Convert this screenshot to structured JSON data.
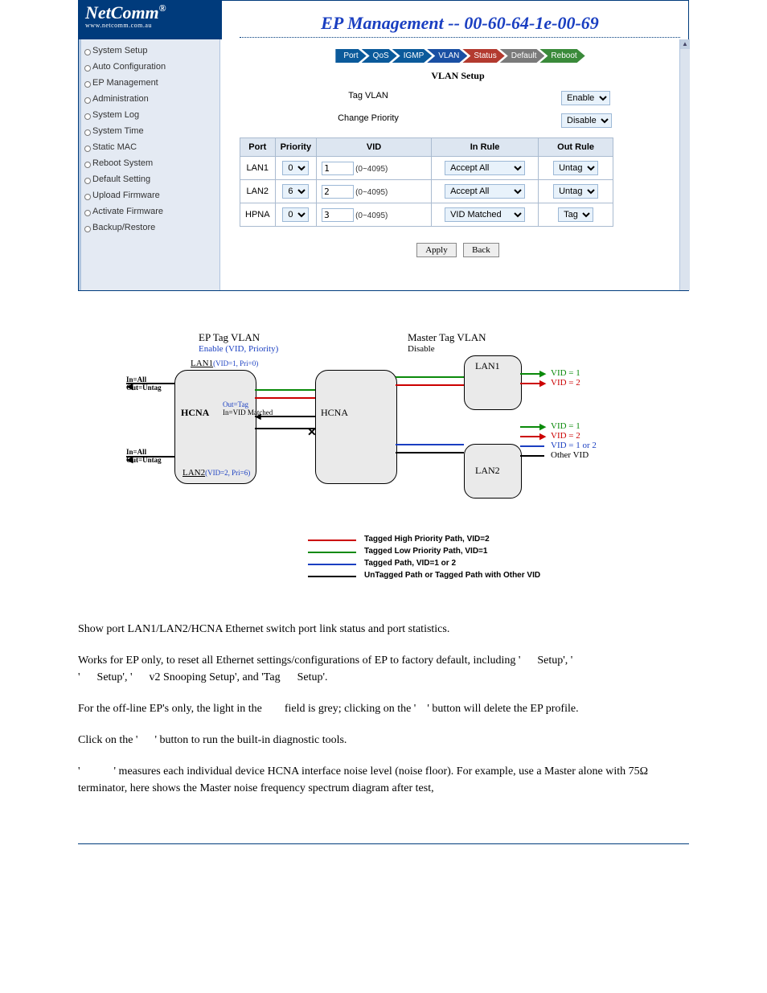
{
  "logo": {
    "brand": "NetComm",
    "url": "www.netcomm.com.au",
    "trademark": "®"
  },
  "header": {
    "title": "EP Management -- 00-60-64-1e-00-69"
  },
  "tabs": [
    {
      "label": "Port",
      "style": "first"
    },
    {
      "label": "QoS",
      "style": ""
    },
    {
      "label": "IGMP",
      "style": ""
    },
    {
      "label": "VLAN",
      "style": "active"
    },
    {
      "label": "Status",
      "style": "red"
    },
    {
      "label": "Default",
      "style": "grey"
    },
    {
      "label": "Reboot",
      "style": "green"
    }
  ],
  "section_title": "VLAN Setup",
  "tag_vlan": {
    "label": "Tag VLAN",
    "value": "Enable"
  },
  "change_priority": {
    "label": "Change Priority",
    "value": "Disable"
  },
  "table": {
    "headers": [
      "Port",
      "Priority",
      "VID",
      "In Rule",
      "Out Rule"
    ],
    "vid_range": "(0~4095)",
    "rows": [
      {
        "port": "LAN1",
        "priority": "0",
        "vid": "1",
        "in_rule": "Accept All",
        "out_rule": "Untag"
      },
      {
        "port": "LAN2",
        "priority": "6",
        "vid": "2",
        "in_rule": "Accept All",
        "out_rule": "Untag"
      },
      {
        "port": "HPNA",
        "priority": "0",
        "vid": "3",
        "in_rule": "VID Matched",
        "out_rule": "Tag"
      }
    ]
  },
  "buttons": {
    "apply": "Apply",
    "back": "Back"
  },
  "sidebar": {
    "items": [
      "System Setup",
      "Auto Configuration",
      "EP Management",
      "Administration",
      "System Log",
      "System Time",
      "Static MAC",
      "Reboot System",
      "Default Setting",
      "Upload Firmware",
      "Activate Firmware",
      "Backup/Restore"
    ]
  },
  "diagram": {
    "ep_title": "EP Tag VLAN",
    "ep_sub": "Enable (VID, Priority)",
    "lan1": "LAN1",
    "lan1_cfg": "(VID=1, Pri=0)",
    "lan2": "LAN2",
    "lan2_cfg": "(VID=2, Pri=6)",
    "rule_in": "In=All",
    "rule_out": "Out=Untag",
    "hcna": "HCNA",
    "hcna_out": "Out=Tag",
    "hcna_in": "In=VID Matched",
    "x_mark": "✕",
    "master_title": "Master Tag VLAN",
    "master_sub": "Disable",
    "m_hcna": "HCNA",
    "m_lan1": "LAN1",
    "m_lan2": "LAN2",
    "vid1": "VID = 1",
    "vid2": "VID = 2",
    "vid1or2": "VID = 1 or 2",
    "othervid": "Other VID",
    "legend": [
      {
        "color": "#c00",
        "text": "Tagged High Priority Path, VID=2"
      },
      {
        "color": "#0a8a0a",
        "text": "Tagged Low Priority Path, VID=1"
      },
      {
        "color": "#1a3fc1",
        "text": "Tagged Path, VID=1 or 2"
      },
      {
        "color": "#000",
        "text": "UnTagged Path or Tagged Path with Other VID"
      }
    ]
  },
  "doc": {
    "p1": "Show port LAN1/LAN2/HCNA Ethernet switch port link status and port statistics.",
    "p2a": "Works for EP only, to reset all Ethernet settings/configurations of EP to factory default, including '",
    "p2b": "Setup', '",
    "p2c": "Setup', '",
    "p2d": "v2 Snooping Setup', and 'Tag",
    "p2e": "Setup'.",
    "p3a": "For the off-line EP's only, the light in the",
    "p3b": "field is grey; clicking on the '",
    "p3c": "' button will delete the EP profile.",
    "p4a": "Click on the '",
    "p4b": "' button to run the built-in diagnostic tools.",
    "p5a": "'",
    "p5b": "' measures each individual device HCNA interface noise level (noise floor). For example, use a Master alone with 75Ω terminator, here shows the Master noise frequency spectrum diagram after test,"
  }
}
